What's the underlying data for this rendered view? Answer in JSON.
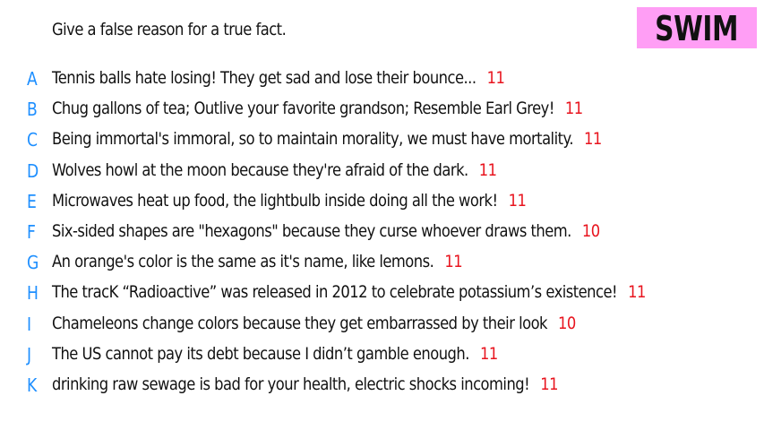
{
  "prompt": "Give a false reason for a true fact.",
  "badge": {
    "label": "SWIM",
    "background": "#ff9ef5"
  },
  "colors": {
    "letter": "#1e8fff",
    "score": "#e8141e",
    "text": "#111111"
  },
  "answers": [
    {
      "letter": "A",
      "text": "Tennis balls hate losing! They get sad and lose their bounce...",
      "score": "11"
    },
    {
      "letter": "B",
      "text": "Chug gallons of tea; Outlive your favorite grandson; Resemble Earl Grey!",
      "score": "11"
    },
    {
      "letter": "C",
      "text": "Being immortal's immoral, so to maintain morality, we must have mortality.",
      "score": "11"
    },
    {
      "letter": "D",
      "text": "Wolves howl at the moon because they're afraid of the dark.",
      "score": "11"
    },
    {
      "letter": "E",
      "text": "Microwaves heat up food, the lightbulb inside doing all the work!",
      "score": "11"
    },
    {
      "letter": "F",
      "text": "Six-sided shapes are \"hexagons\" because they curse whoever draws them.",
      "score": "10"
    },
    {
      "letter": "G",
      "text": "An orange's color is the same as it's name, like lemons.",
      "score": "11"
    },
    {
      "letter": "H",
      "text": "The tracK “Radioactive” was released in 2012 to celebrate potassium’s existence!",
      "score": "11"
    },
    {
      "letter": "I",
      "text": "Chameleons change colors because they get embarrassed by their look",
      "score": "10"
    },
    {
      "letter": "J",
      "text": "The US cannot pay its debt because I didn’t gamble enough.",
      "score": "11"
    },
    {
      "letter": "K",
      "text": "drinking raw sewage is bad for your health, electric shocks incoming!",
      "score": "11"
    }
  ]
}
